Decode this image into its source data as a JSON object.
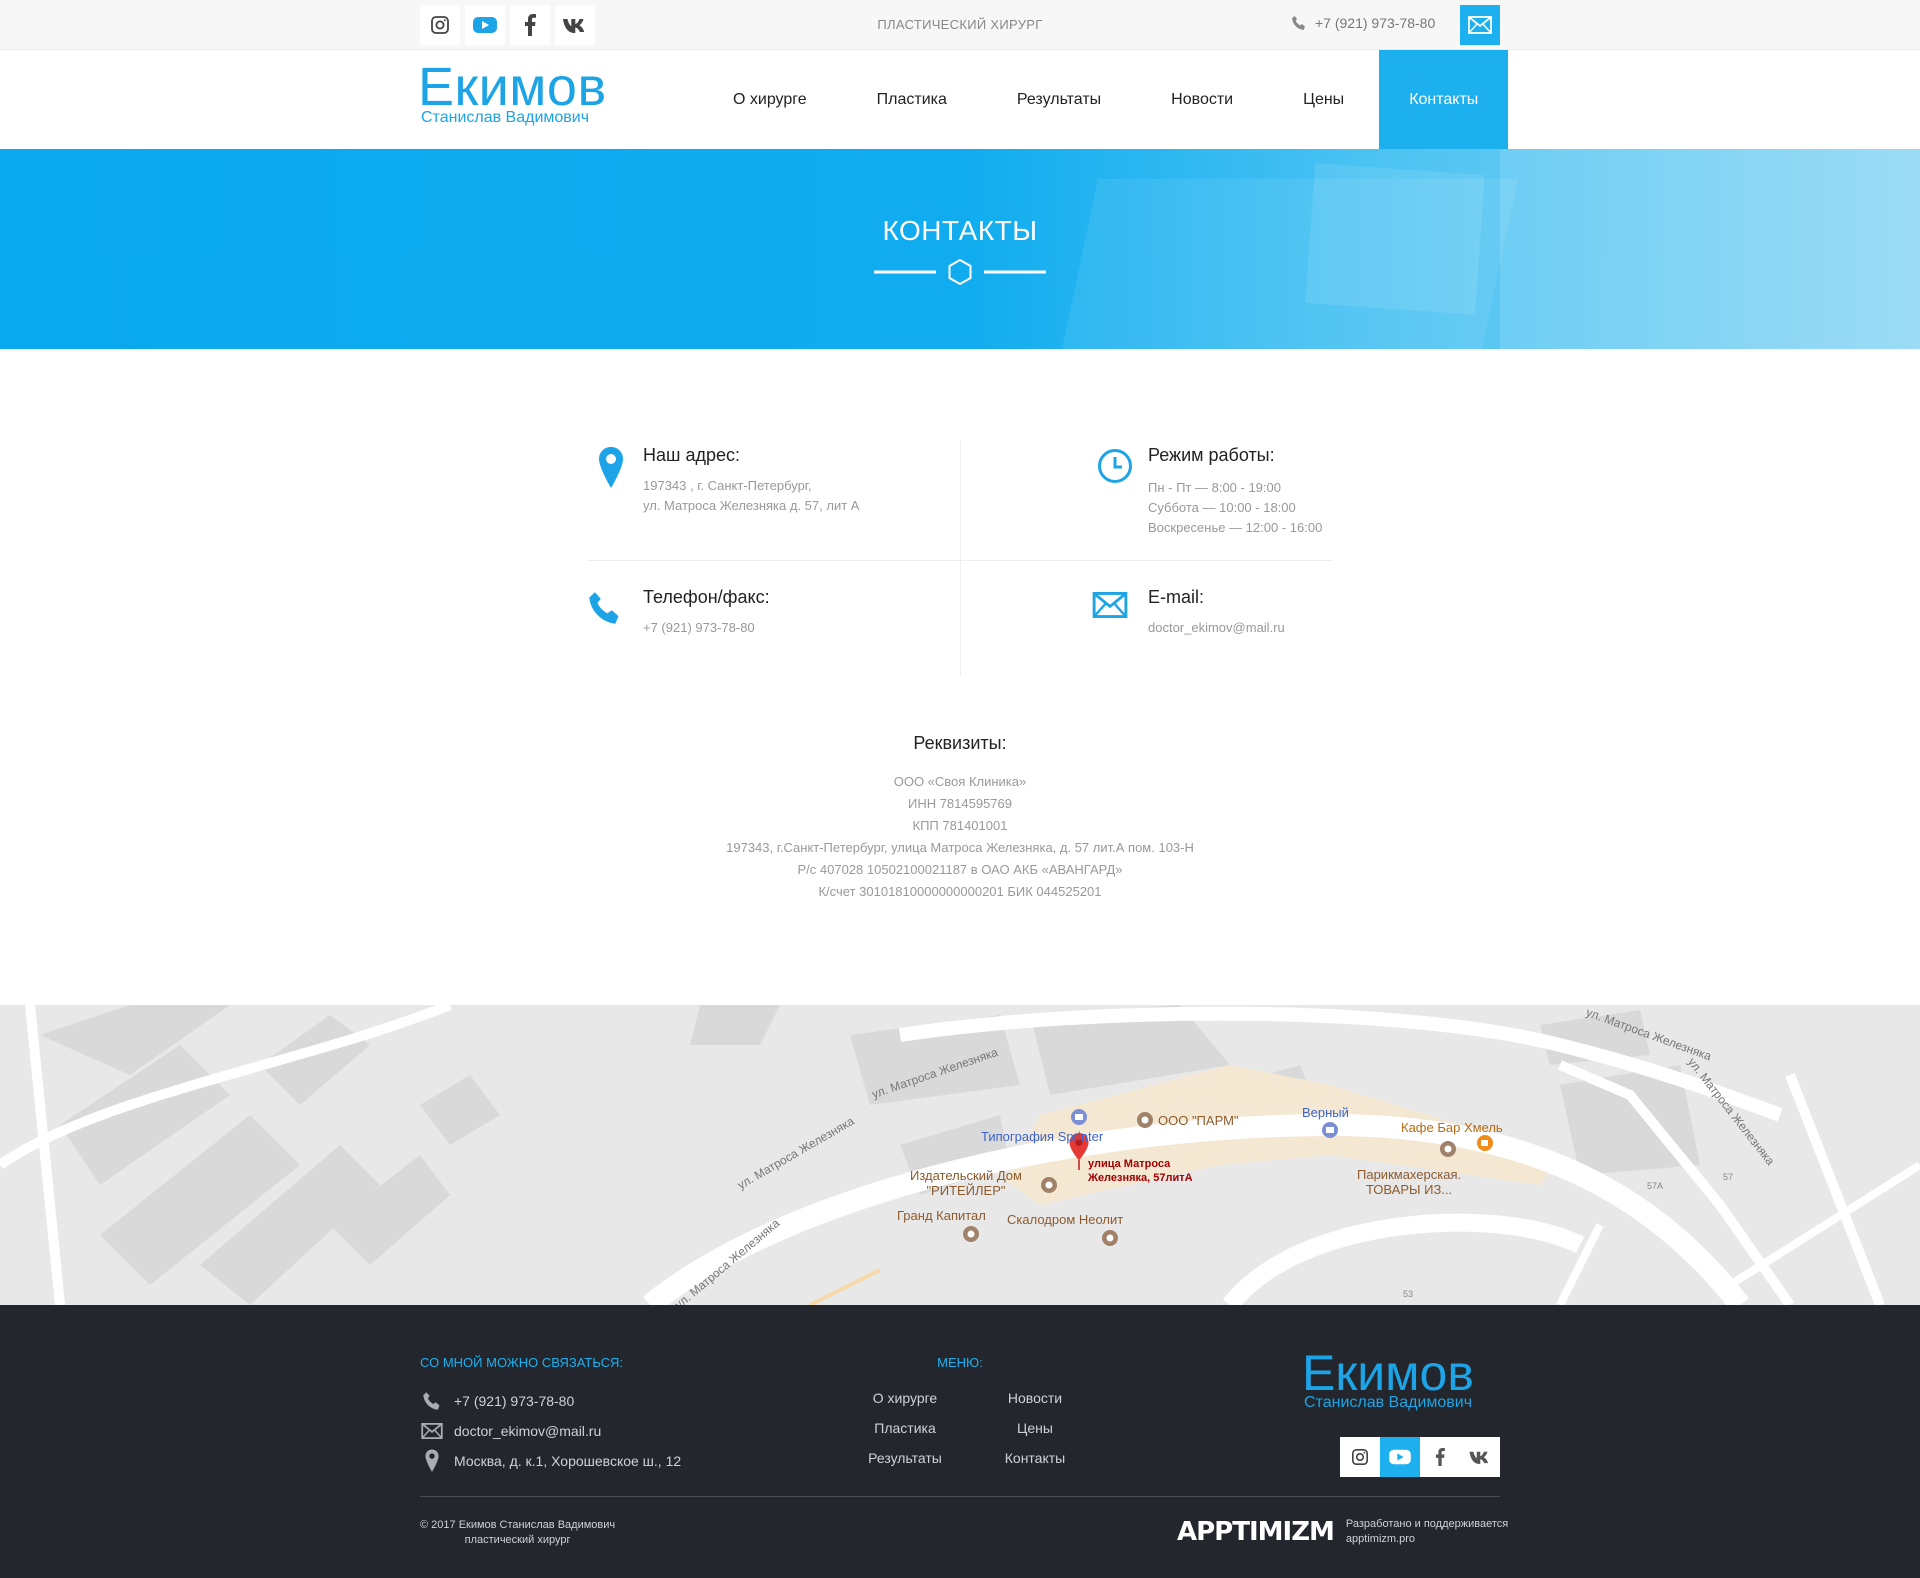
{
  "topbar": {
    "socials": [
      "instagram-icon",
      "youtube-icon",
      "facebook-icon",
      "vk-icon"
    ],
    "specialty": "Пластический хирург",
    "phone": "+7 (921) 973-78-80"
  },
  "header": {
    "logo_line1": "Екимов",
    "logo_line2": "Станислав Вадимович",
    "nav": [
      "О хирурге",
      "Пластика",
      "Результаты",
      "Новости",
      "Цены",
      "Контакты"
    ]
  },
  "hero": {
    "title": "КОНТАКТЫ"
  },
  "contacts": {
    "address": {
      "title": "Наш адрес:",
      "line1": "197343 , г. Санкт-Петербург,",
      "line2": "ул. Матроса Железняка д. 57, лит А"
    },
    "hours": {
      "title": "Режим работы:",
      "line1": "Пн - Пт — 8:00 - 19:00",
      "line2": "Суббота — 10:00 - 18:00",
      "line3": "Воскресенье — 12:00 - 16:00"
    },
    "phone": {
      "title": "Телефон/факс:",
      "value": "+7 (921) 973-78-80"
    },
    "email": {
      "title": "E-mail:",
      "value": "doctor_ekimov@mail.ru"
    }
  },
  "requisites": {
    "title": "Реквизиты:",
    "lines": [
      "ООО «Своя Клиника»",
      "ИНН 7814595769",
      "КПП 781401001",
      "197343, г.Санкт-Петербург, улица Матроса Железняка, д. 57 лит.А пом. 103-Н",
      "Р/с 407028 10502100021187 в ОАО АКБ «АВАНГАРД»",
      "К/счет 30101810000000000201 БИК 044525201"
    ]
  },
  "map": {
    "street_labels": [
      "ул. Матроса Железняка",
      "ул. Матроса Железняка",
      "ул. Матроса Железняка",
      "ул. Матроса Железняка",
      "ул. Матроса Железняка"
    ],
    "places": {
      "tipografiya": "Типография Sprinter",
      "parm": "ООО \"ПАРМ\"",
      "verny": "Верный",
      "kafe": "Кафе Бар Хмель",
      "izdatelsky1": "Издательский Дом",
      "izdatelsky2": "\"РИТЕЙЛЕР\"",
      "addr1": "улица Матроса",
      "addr2": "Железняка, 57литА",
      "parikmaher1": "Парикмахерская.",
      "parikmaher2": "ТОВАРЫ ИЗ...",
      "grand": "Гранд Капитал",
      "skalodrom": "Скалодром Неолит"
    },
    "numbers": [
      "57А",
      "57",
      "53"
    ]
  },
  "footer": {
    "contact_title": "Со мной можно связаться:",
    "phone": "+7 (921) 973-78-80",
    "email": "doctor_ekimov@mail.ru",
    "address": "Москва, д. к.1, Хорошевское ш., 12",
    "menu_title": "Меню:",
    "menu": [
      "О хирурге",
      "Новости",
      "Пластика",
      "Цены",
      "Результаты",
      "Контакты"
    ],
    "logo_line1": "Екимов",
    "logo_line2": "Станислав Вадимович",
    "copyright_line1": "© 2017 Екимов Станислав Вадимович",
    "copyright_line2": "пластический хирург",
    "dev_brand": "APPTIMIZM",
    "dev_line1": "Разработано и поддерживается",
    "dev_line2": "apptimizm.pro"
  },
  "colors": {
    "accent": "#1cb0ef",
    "footer_bg": "#23262d",
    "text_muted": "#999999"
  }
}
